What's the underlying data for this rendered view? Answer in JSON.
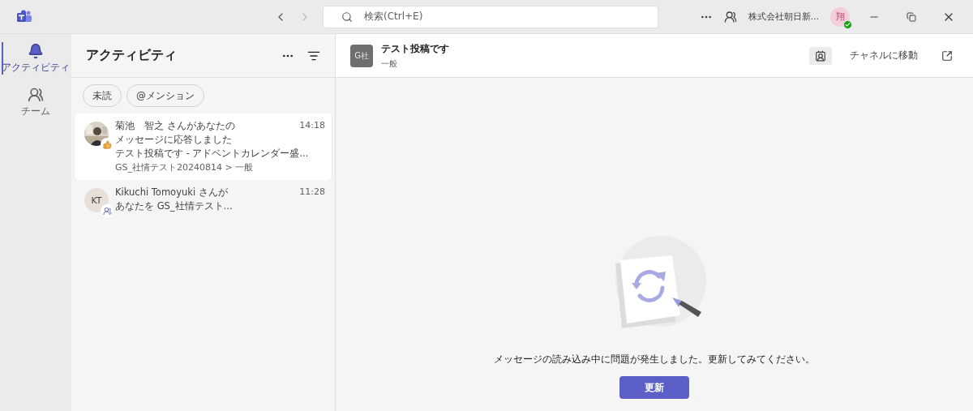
{
  "titlebar": {
    "search_placeholder": "検索(Ctrl+E)",
    "org": "株式会社朝日新...",
    "avatar": "翔",
    "available": true
  },
  "rail": [
    {
      "label": "アクティビティ",
      "kind": "activity",
      "selected": true
    },
    {
      "label": "チーム",
      "kind": "teams",
      "selected": false
    }
  ],
  "activity": {
    "title": "アクティビティ",
    "filters": [
      {
        "label": "未読",
        "selected": false
      },
      {
        "label": "@メンション",
        "selected": false
      }
    ],
    "items": [
      {
        "kind": "reaction",
        "lines": [
          "菊池　智之 さんがあなたの",
          "メッセージに応答しました",
          "テスト投稿です - アドベントカレンダー盛..."
        ],
        "path": "GS_社情テスト20240814 > 一般",
        "time": "14:18",
        "selected": true
      },
      {
        "kind": "added",
        "initials": "KT",
        "lines": [
          "Kikuchi Tomoyuki さんが",
          "あなたを GS_社情テスト..."
        ],
        "time": "11:28",
        "selected": false
      }
    ]
  },
  "channel": {
    "avatar": "G社",
    "title": "テスト投稿です",
    "subtitle": "一般",
    "go_to_channel": "チャネルに移動"
  },
  "error": {
    "message": "メッセージの読み込み中に問題が発生しました。更新してみてください。",
    "button": "更新"
  }
}
